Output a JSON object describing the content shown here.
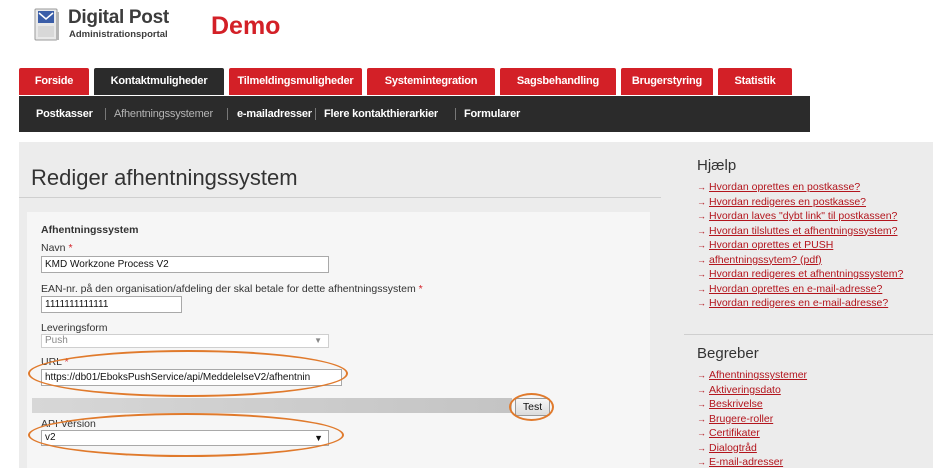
{
  "brand": {
    "name": "Digital Post",
    "subtitle": "Administrationsportal",
    "env": "Demo"
  },
  "tabs": [
    {
      "label": "Forside",
      "active": false
    },
    {
      "label": "Kontaktmuligheder",
      "active": true
    },
    {
      "label": "Tilmeldingsmuligheder",
      "active": false
    },
    {
      "label": "Systemintegration",
      "active": false
    },
    {
      "label": "Sagsbehandling",
      "active": false
    },
    {
      "label": "Brugerstyring",
      "active": false
    },
    {
      "label": "Statistik",
      "active": false
    }
  ],
  "subnav": [
    {
      "label": "Postkasser",
      "active": true
    },
    {
      "label": "Afhentningssystemer",
      "active": false
    },
    {
      "label": "e-mailadresser",
      "active": true
    },
    {
      "label": "Flere kontakthierarkier",
      "active": true
    },
    {
      "label": "Formularer",
      "active": true
    }
  ],
  "page": {
    "title": "Rediger afhentningssystem"
  },
  "form": {
    "section": "Afhentningssystem",
    "name_label": "Navn",
    "name_value": "KMD Workzone Process V2",
    "ean_label": "EAN-nr. på den organisation/afdeling der skal betale for dette afhentningssystem",
    "ean_value": "1111111111111",
    "delivery_label": "Leveringsform",
    "delivery_value": "Push",
    "url_label": "URL",
    "url_value": "https://db01/EboksPushService/api/MeddelelseV2/afhentnin",
    "test_label": "Test",
    "api_label": "API Version",
    "api_value": "v2",
    "required_mark": "*",
    "dropdown_arrow": "▼"
  },
  "help": {
    "title": "Hjælp",
    "links": [
      "Hvordan oprettes en postkasse?",
      "Hvordan redigeres en postkasse?",
      "Hvordan laves \"dybt link\" til postkassen?",
      "Hvordan tilsluttes et afhentningssystem?",
      "Hvordan oprettes et PUSH",
      "afhentningssytem? (pdf)",
      "Hvordan redigeres et afhentningssystem?",
      "Hvordan oprettes en e-mail-adresse?",
      "Hvordan redigeres en e-mail-adresse?"
    ]
  },
  "terms": {
    "title": "Begreber",
    "links": [
      "Afhentningssystemer",
      "Aktiveringsdato",
      "Beskrivelse",
      "Brugere-roller",
      "Certifikater",
      "Dialogtråd",
      "E-mail-adresser"
    ]
  },
  "colors": {
    "brand_red": "#d32027",
    "dark_nav": "#2b2b2b",
    "highlight": "#e07a2c",
    "link": "#b3151d"
  }
}
